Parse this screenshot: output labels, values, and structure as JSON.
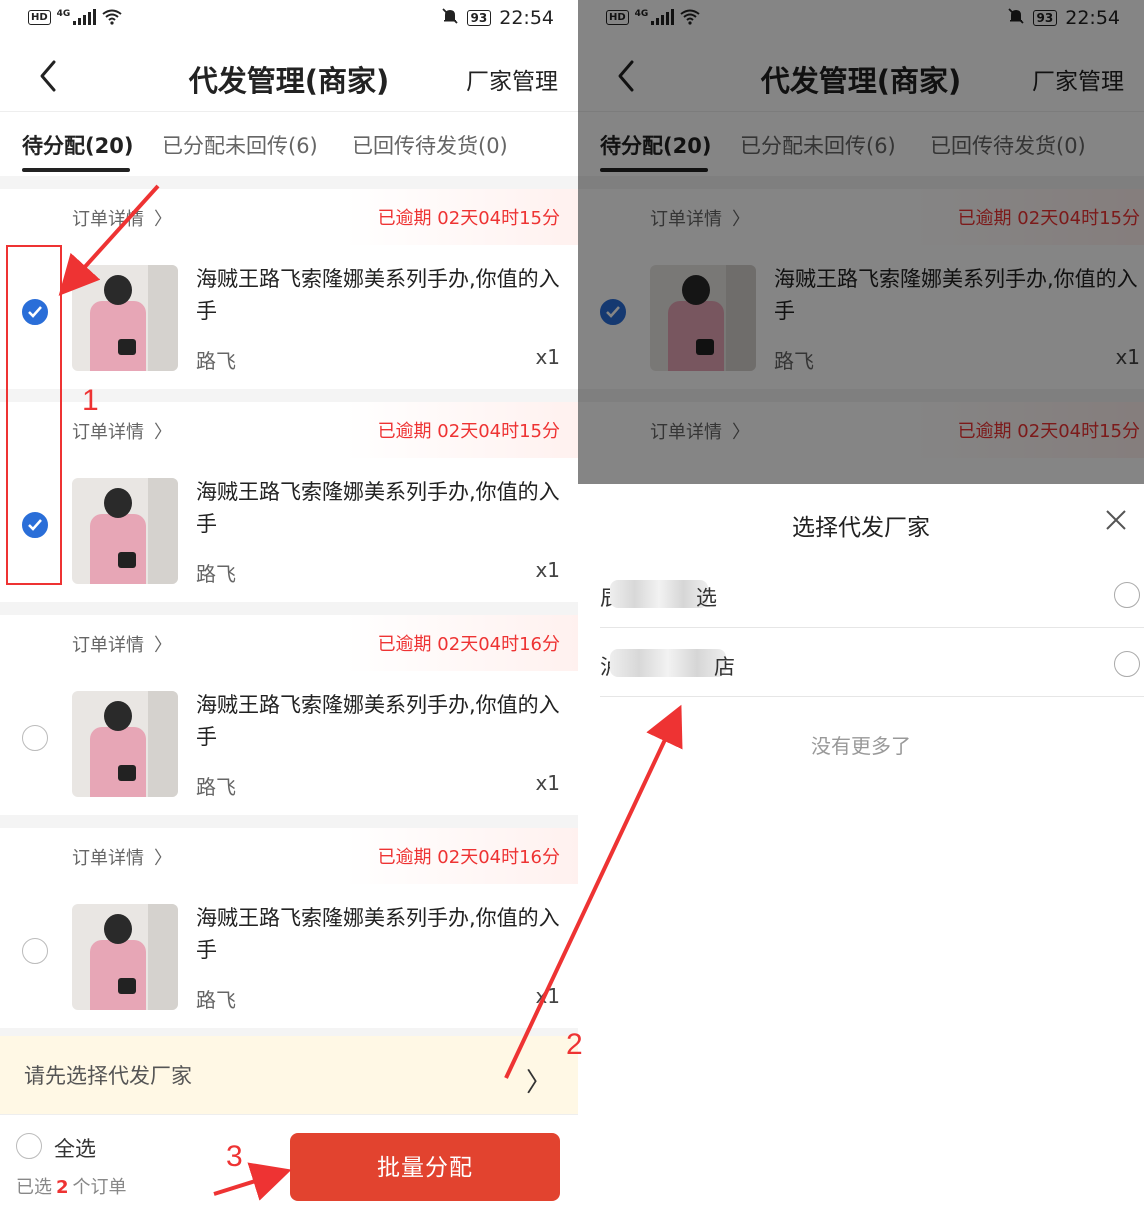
{
  "status": {
    "time": "22:54",
    "battery": "93",
    "hd": "HD",
    "net": "4G"
  },
  "header": {
    "title": "代发管理(商家)",
    "link": "厂家管理"
  },
  "tabs": [
    {
      "label": "待分配(20)",
      "active": true
    },
    {
      "label": "已分配未回传(6)",
      "active": false
    },
    {
      "label": "已回传待发货(0)",
      "active": false
    }
  ],
  "orders": [
    {
      "detail": "订单详情",
      "overdue": "已逾期 02天04时15分",
      "product": "海贼王路飞索隆娜美系列手办,你值的入手",
      "spec": "路飞",
      "qty": "x1",
      "checked": true
    },
    {
      "detail": "订单详情",
      "overdue": "已逾期 02天04时15分",
      "product": "海贼王路飞索隆娜美系列手办,你值的入手",
      "spec": "路飞",
      "qty": "x1",
      "checked": true
    },
    {
      "detail": "订单详情",
      "overdue": "已逾期 02天04时16分",
      "product": "海贼王路飞索隆娜美系列手办,你值的入手",
      "spec": "路飞",
      "qty": "x1",
      "checked": false
    },
    {
      "detail": "订单详情",
      "overdue": "已逾期 02天04时16分",
      "product": "海贼王路飞索隆娜美系列手办,你值的入手",
      "spec": "路飞",
      "qty": "x1",
      "checked": false
    }
  ],
  "tip": {
    "text": "请先选择代发厂家"
  },
  "footer": {
    "select_all": "全选",
    "selected_prefix": "已选",
    "selected_count": "2",
    "selected_suffix": "个订单",
    "batch_button": "批量分配"
  },
  "annotations": {
    "step1": "1",
    "step2": "2",
    "step3": "3"
  },
  "sheet": {
    "title": "选择代发厂家",
    "options": [
      {
        "first_char": "辰",
        "last_char": "选"
      },
      {
        "first_char": "泸",
        "last_char": "店"
      }
    ],
    "no_more": "没有更多了"
  },
  "colors": {
    "accent": "#e2432f",
    "check": "#2a6ed8",
    "overdue": "#ee3333",
    "tip_bg": "#fff8e5"
  },
  "icons": {
    "back": "chevron-left-icon",
    "detail_chevron": "chevron-right-icon",
    "close": "close-icon",
    "check": "check-icon",
    "mute": "bell-off-icon",
    "wifi": "wifi-icon"
  }
}
